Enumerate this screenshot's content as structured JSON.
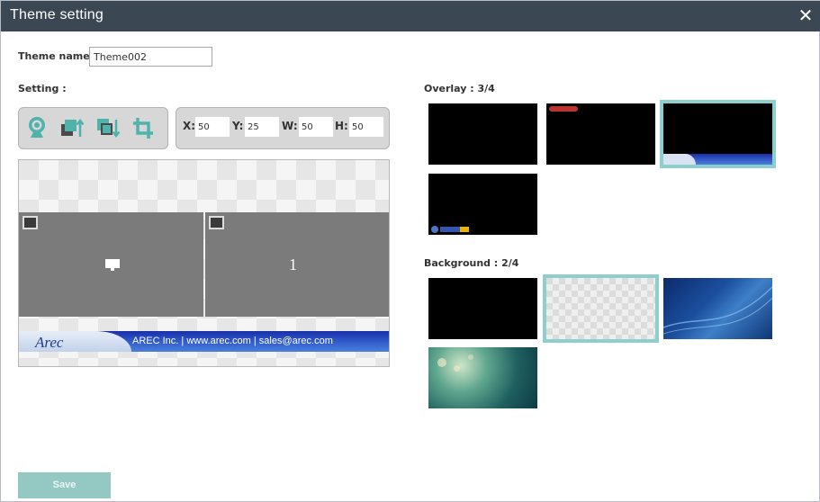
{
  "dialog": {
    "title": "Theme setting",
    "close_label": "✕"
  },
  "theme_name": {
    "label": "Theme name :",
    "value": "Theme002"
  },
  "setting": {
    "label": "Setting :"
  },
  "tools": [
    {
      "name": "webcam-icon"
    },
    {
      "name": "bring-to-front-icon"
    },
    {
      "name": "send-to-back-icon"
    },
    {
      "name": "crop-icon"
    }
  ],
  "coords": {
    "x": {
      "label": "X:",
      "value": "50"
    },
    "y": {
      "label": "Y:",
      "value": "25"
    },
    "w": {
      "label": "W:",
      "value": "50"
    },
    "h": {
      "label": "H:",
      "value": "50"
    }
  },
  "preview": {
    "window2_label": "1",
    "footer_logo": "Arec",
    "footer_text": "AREC Inc.  |   www.arec.com  |  sales@arec.com"
  },
  "overlay": {
    "label": "Overlay : 3/4",
    "selected_index": 3,
    "count": 4
  },
  "background": {
    "label": "Background : 2/4",
    "selected_index": 2,
    "count": 4
  },
  "save_label": "Save",
  "colors": {
    "titlebar": "#3c4754",
    "accent": "#8dcfcc",
    "save": "#93c8c3"
  }
}
